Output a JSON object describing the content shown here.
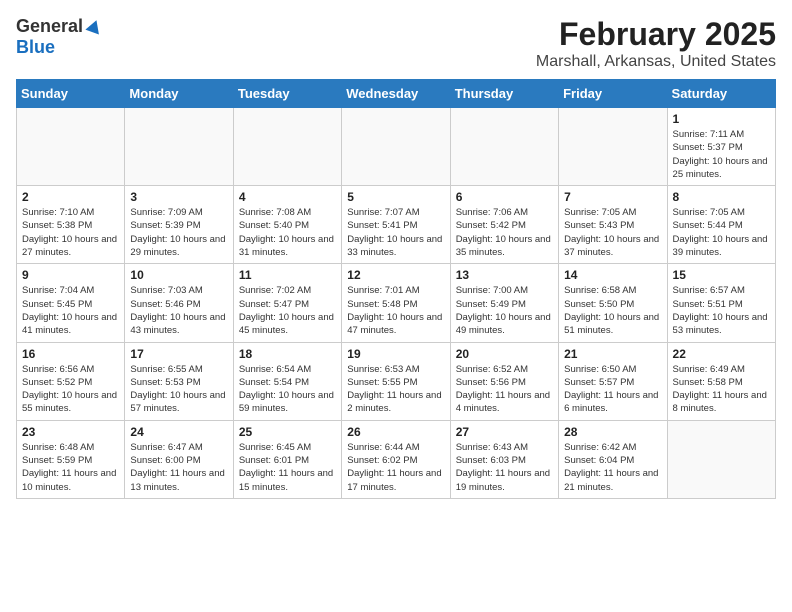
{
  "header": {
    "logo_general": "General",
    "logo_blue": "Blue",
    "title": "February 2025",
    "subtitle": "Marshall, Arkansas, United States"
  },
  "calendar": {
    "days_of_week": [
      "Sunday",
      "Monday",
      "Tuesday",
      "Wednesday",
      "Thursday",
      "Friday",
      "Saturday"
    ],
    "weeks": [
      [
        {
          "day": "",
          "info": ""
        },
        {
          "day": "",
          "info": ""
        },
        {
          "day": "",
          "info": ""
        },
        {
          "day": "",
          "info": ""
        },
        {
          "day": "",
          "info": ""
        },
        {
          "day": "",
          "info": ""
        },
        {
          "day": "1",
          "info": "Sunrise: 7:11 AM\nSunset: 5:37 PM\nDaylight: 10 hours and 25 minutes."
        }
      ],
      [
        {
          "day": "2",
          "info": "Sunrise: 7:10 AM\nSunset: 5:38 PM\nDaylight: 10 hours and 27 minutes."
        },
        {
          "day": "3",
          "info": "Sunrise: 7:09 AM\nSunset: 5:39 PM\nDaylight: 10 hours and 29 minutes."
        },
        {
          "day": "4",
          "info": "Sunrise: 7:08 AM\nSunset: 5:40 PM\nDaylight: 10 hours and 31 minutes."
        },
        {
          "day": "5",
          "info": "Sunrise: 7:07 AM\nSunset: 5:41 PM\nDaylight: 10 hours and 33 minutes."
        },
        {
          "day": "6",
          "info": "Sunrise: 7:06 AM\nSunset: 5:42 PM\nDaylight: 10 hours and 35 minutes."
        },
        {
          "day": "7",
          "info": "Sunrise: 7:05 AM\nSunset: 5:43 PM\nDaylight: 10 hours and 37 minutes."
        },
        {
          "day": "8",
          "info": "Sunrise: 7:05 AM\nSunset: 5:44 PM\nDaylight: 10 hours and 39 minutes."
        }
      ],
      [
        {
          "day": "9",
          "info": "Sunrise: 7:04 AM\nSunset: 5:45 PM\nDaylight: 10 hours and 41 minutes."
        },
        {
          "day": "10",
          "info": "Sunrise: 7:03 AM\nSunset: 5:46 PM\nDaylight: 10 hours and 43 minutes."
        },
        {
          "day": "11",
          "info": "Sunrise: 7:02 AM\nSunset: 5:47 PM\nDaylight: 10 hours and 45 minutes."
        },
        {
          "day": "12",
          "info": "Sunrise: 7:01 AM\nSunset: 5:48 PM\nDaylight: 10 hours and 47 minutes."
        },
        {
          "day": "13",
          "info": "Sunrise: 7:00 AM\nSunset: 5:49 PM\nDaylight: 10 hours and 49 minutes."
        },
        {
          "day": "14",
          "info": "Sunrise: 6:58 AM\nSunset: 5:50 PM\nDaylight: 10 hours and 51 minutes."
        },
        {
          "day": "15",
          "info": "Sunrise: 6:57 AM\nSunset: 5:51 PM\nDaylight: 10 hours and 53 minutes."
        }
      ],
      [
        {
          "day": "16",
          "info": "Sunrise: 6:56 AM\nSunset: 5:52 PM\nDaylight: 10 hours and 55 minutes."
        },
        {
          "day": "17",
          "info": "Sunrise: 6:55 AM\nSunset: 5:53 PM\nDaylight: 10 hours and 57 minutes."
        },
        {
          "day": "18",
          "info": "Sunrise: 6:54 AM\nSunset: 5:54 PM\nDaylight: 10 hours and 59 minutes."
        },
        {
          "day": "19",
          "info": "Sunrise: 6:53 AM\nSunset: 5:55 PM\nDaylight: 11 hours and 2 minutes."
        },
        {
          "day": "20",
          "info": "Sunrise: 6:52 AM\nSunset: 5:56 PM\nDaylight: 11 hours and 4 minutes."
        },
        {
          "day": "21",
          "info": "Sunrise: 6:50 AM\nSunset: 5:57 PM\nDaylight: 11 hours and 6 minutes."
        },
        {
          "day": "22",
          "info": "Sunrise: 6:49 AM\nSunset: 5:58 PM\nDaylight: 11 hours and 8 minutes."
        }
      ],
      [
        {
          "day": "23",
          "info": "Sunrise: 6:48 AM\nSunset: 5:59 PM\nDaylight: 11 hours and 10 minutes."
        },
        {
          "day": "24",
          "info": "Sunrise: 6:47 AM\nSunset: 6:00 PM\nDaylight: 11 hours and 13 minutes."
        },
        {
          "day": "25",
          "info": "Sunrise: 6:45 AM\nSunset: 6:01 PM\nDaylight: 11 hours and 15 minutes."
        },
        {
          "day": "26",
          "info": "Sunrise: 6:44 AM\nSunset: 6:02 PM\nDaylight: 11 hours and 17 minutes."
        },
        {
          "day": "27",
          "info": "Sunrise: 6:43 AM\nSunset: 6:03 PM\nDaylight: 11 hours and 19 minutes."
        },
        {
          "day": "28",
          "info": "Sunrise: 6:42 AM\nSunset: 6:04 PM\nDaylight: 11 hours and 21 minutes."
        },
        {
          "day": "",
          "info": ""
        }
      ]
    ]
  }
}
